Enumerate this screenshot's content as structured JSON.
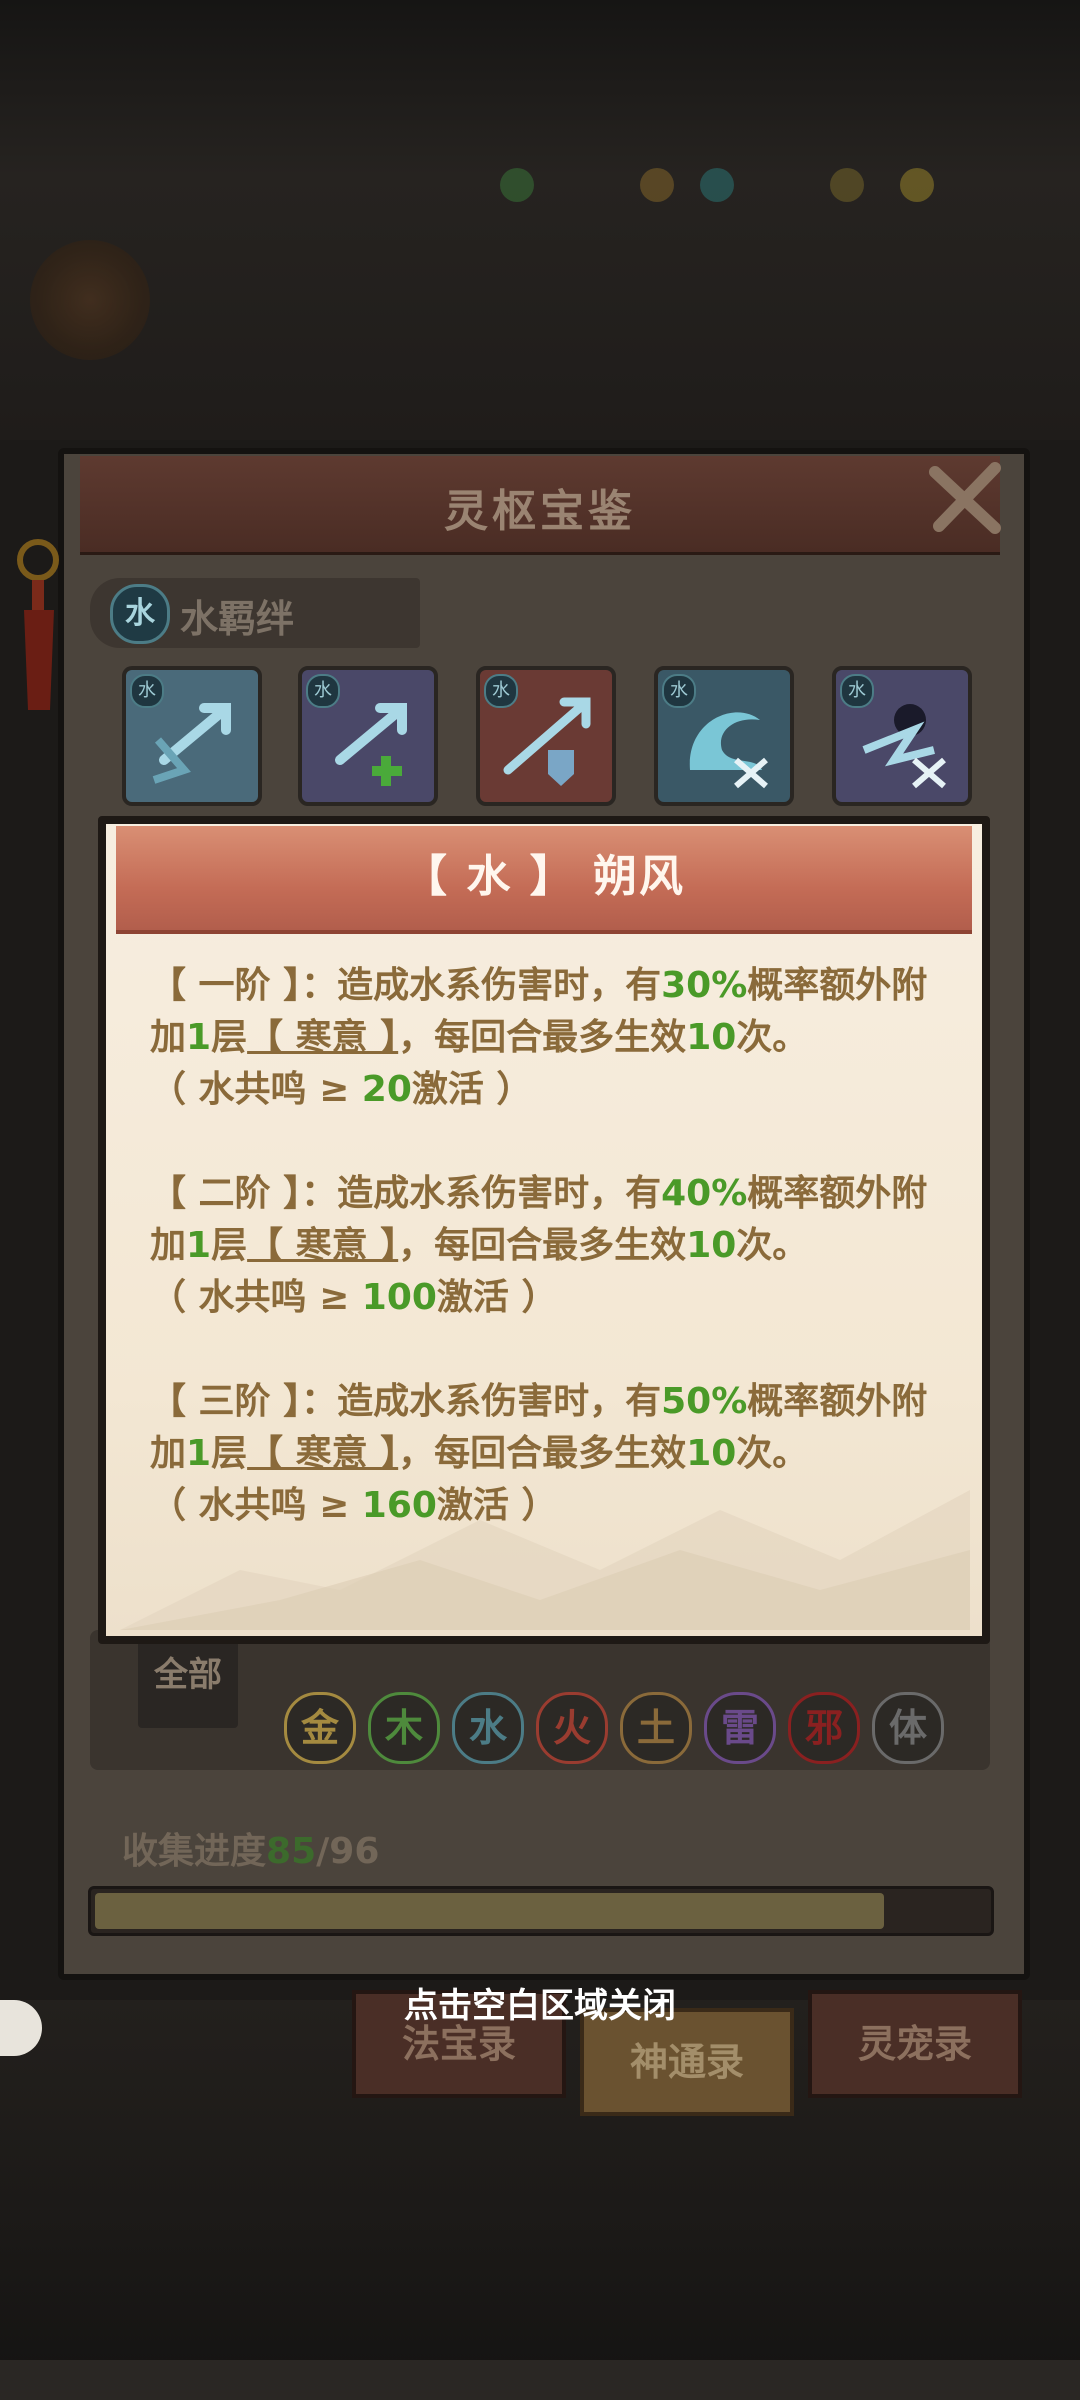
{
  "panel": {
    "title": "灵枢宝鉴",
    "section_badge": "水",
    "section_label": "水羁绊"
  },
  "skill_cards": [
    {
      "badge": "水",
      "icon": "ice-arrow-icon",
      "color": "#4a6a7a"
    },
    {
      "badge": "水",
      "icon": "ice-arrow-plus-icon",
      "color": "#4a4868"
    },
    {
      "badge": "水",
      "icon": "arrow-shield-icon",
      "color": "#6a3a34"
    },
    {
      "badge": "水",
      "icon": "wave-icon",
      "color": "#3a5866"
    },
    {
      "badge": "水",
      "icon": "frost-blast-icon",
      "color": "#4a4868"
    }
  ],
  "filters": {
    "all_label": "全部",
    "elements": [
      {
        "label": "金",
        "color": "#a48a40"
      },
      {
        "label": "木",
        "color": "#4e8a3c"
      },
      {
        "label": "水",
        "color": "#4c7c86"
      },
      {
        "label": "火",
        "color": "#9a3c30"
      },
      {
        "label": "土",
        "color": "#8a6a3a"
      },
      {
        "label": "雷",
        "color": "#6a4a8a"
      },
      {
        "label": "邪",
        "color": "#8a2020"
      },
      {
        "label": "体",
        "color": "#6a6a6a"
      }
    ]
  },
  "progress": {
    "label": "收集进度",
    "collected": "85",
    "total_text": "/96",
    "fraction": 0.885
  },
  "bottom_tabs": [
    {
      "label": "法宝录",
      "active": false
    },
    {
      "label": "神通录",
      "active": true
    },
    {
      "label": "灵宠录",
      "active": false
    }
  ],
  "hint": "点击空白区域关闭",
  "popup": {
    "title": "【 水 】 朔风",
    "tiers": [
      {
        "name": "【 一阶 】",
        "text1": "：造成水系伤害时，有",
        "percent": "30%",
        "text2": "概率额外附加",
        "layers": "1",
        "text3": "层",
        "buff": "【 寒意 】",
        "text4": "，每回合最多生效",
        "times": "10",
        "text5": "次。",
        "cond1": "（ 水共鸣 ≥ ",
        "threshold": "20",
        "cond2": "激活 ）"
      },
      {
        "name": "【 二阶 】",
        "text1": "：造成水系伤害时，有",
        "percent": "40%",
        "text2": "概率额外附加",
        "layers": "1",
        "text3": "层",
        "buff": "【 寒意 】",
        "text4": "，每回合最多生效",
        "times": "10",
        "text5": "次。",
        "cond1": "（ 水共鸣 ≥ ",
        "threshold": "100",
        "cond2": "激活 ）"
      },
      {
        "name": "【 三阶 】",
        "text1": "：造成水系伤害时，有",
        "percent": "50%",
        "text2": "概率额外附加",
        "layers": "1",
        "text3": "层",
        "buff": "【 寒意 】",
        "text4": "，每回合最多生效",
        "times": "10",
        "text5": "次。",
        "cond1": "（ 水共鸣 ≥ ",
        "threshold": "160",
        "cond2": "激活 ）"
      }
    ]
  }
}
